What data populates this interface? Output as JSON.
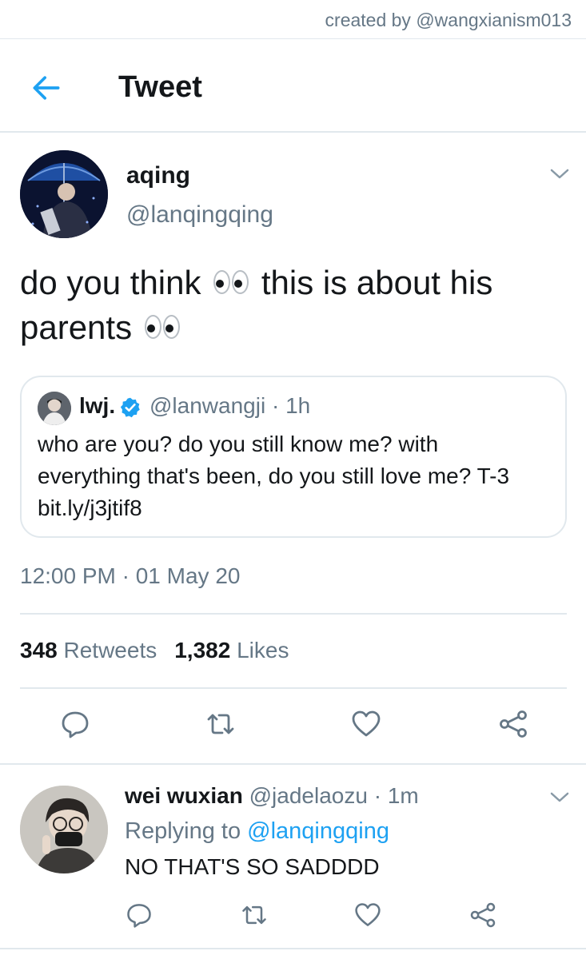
{
  "watermark": "created by @wangxianism013",
  "header": {
    "title": "Tweet",
    "back_icon": "arrow-left-icon"
  },
  "tweet": {
    "name": "aqing",
    "handle": "@lanqingqing",
    "text_part1": "do you think",
    "text_part2": "this is about his",
    "text_part3": "parents",
    "emoji": "eyes-emoji",
    "timestamp": "12:00 PM · 01 May 20",
    "retweets_count": "348",
    "retweets_label": "Retweets",
    "likes_count": "1,382",
    "likes_label": "Likes"
  },
  "quote": {
    "name": "lwj.",
    "verified": true,
    "handle": "@lanwangji",
    "time": "1h",
    "line1": "who are you? do you still know me? with",
    "line2": "everything that's been, do you still love me? T-3",
    "line3": "bit.ly/j3jtif8"
  },
  "reply": {
    "name": "wei wuxian",
    "handle": "@jadelaozu",
    "time": "1m",
    "replying_label": "Replying to",
    "replying_handle": "@lanqingqing",
    "text": "NO THAT'S SO SADDDD"
  },
  "colors": {
    "accent": "#1da1f2",
    "muted": "#657786",
    "text": "#14171a",
    "border": "#e1e8ed"
  }
}
